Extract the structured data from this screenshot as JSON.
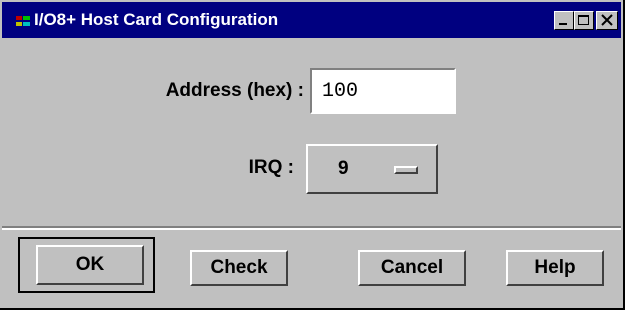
{
  "window": {
    "title": "I/O8+ Host Card Configuration",
    "title_icon": "app-icon",
    "controls": [
      "minimize-icon",
      "maximize-icon",
      "close-icon"
    ]
  },
  "form": {
    "address_label": "Address (hex) :",
    "address_value": "100",
    "irq_label": "IRQ :",
    "irq_value": "9"
  },
  "buttons": {
    "ok": "OK",
    "check": "Check",
    "cancel": "Cancel",
    "help": "Help"
  },
  "colors": {
    "titlebar": "#000080",
    "face": "#c0c0c0",
    "field": "#ffffff"
  }
}
